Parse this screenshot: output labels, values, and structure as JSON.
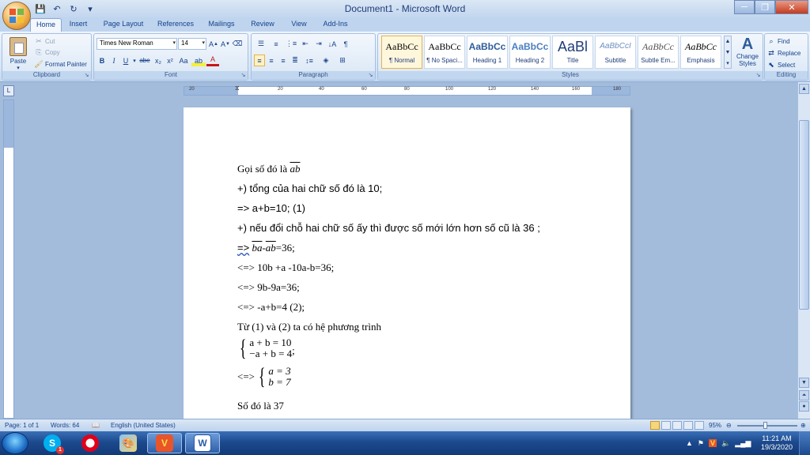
{
  "window": {
    "title": "Document1 - Microsoft Word",
    "minimize_icon": "minimize-icon",
    "maximize_icon": "restore-icon",
    "close_icon": "close-icon"
  },
  "quick_access": [
    "save-icon",
    "undo-icon",
    "redo-icon",
    "customize-icon"
  ],
  "ribbon_tabs": [
    "Home",
    "Insert",
    "Page Layout",
    "References",
    "Mailings",
    "Review",
    "View",
    "Add-Ins"
  ],
  "clipboard": {
    "paste": "Paste",
    "cut": "Cut",
    "copy": "Copy",
    "format_painter": "Format Painter",
    "label": "Clipboard"
  },
  "font": {
    "name": "Times New Roman",
    "size": "14",
    "label": "Font",
    "buttons": [
      "B",
      "I",
      "U",
      "abe",
      "x₂",
      "x²",
      "Aa"
    ]
  },
  "paragraph": {
    "label": "Paragraph"
  },
  "styles": {
    "label": "Styles",
    "items": [
      {
        "sample": "AaBbCc",
        "name": "¶ Normal"
      },
      {
        "sample": "AaBbCc",
        "name": "¶ No Spaci..."
      },
      {
        "sample": "AaBbCc",
        "name": "Heading 1"
      },
      {
        "sample": "AaBbCc",
        "name": "Heading 2"
      },
      {
        "sample": "AaBl",
        "name": "Title"
      },
      {
        "sample": "AaBbCcI",
        "name": "Subtitle"
      },
      {
        "sample": "AaBbCc",
        "name": "Subtle Em..."
      },
      {
        "sample": "AaBbCc",
        "name": "Emphasis"
      }
    ],
    "change_styles": "Change Styles"
  },
  "editing": {
    "label": "Editing",
    "find": "Find",
    "replace": "Replace",
    "select": "Select"
  },
  "ruler": {
    "numbers": [
      "20",
      "20",
      "40",
      "60",
      "80",
      "100",
      "120",
      "140",
      "160",
      "180"
    ]
  },
  "document": {
    "lines": {
      "l1_prefix": "Gọi số đó là ",
      "l1_overline": "ab",
      "l2": "+) tổng của hai chữ số đó là 10;",
      "l3": "=> a+b=10;   (1)",
      "l4": "+) nếu đổi chỗ hai chữ số ấy thì được số mới lớn hơn số cũ là 36 ;",
      "l5_prefix": "=>",
      "l5_a": "ba",
      "l5_sep": "-",
      "l5_b": "ab",
      "l5_suffix": "=36;",
      "l6": "<=> 10b +a -10a-b=36;",
      "l7": "<=> 9b-9a=36;",
      "l8": "<=> -a+b=4    (2);",
      "l9": "Từ (1) và (2) ta có hệ phương trình",
      "sys1_row1": "a + b = 10",
      "sys1_row2": "−a + b = 4",
      "sys1_tail": ";",
      "sys2_prefix": "<=>",
      "sys2_row1": "a = 3",
      "sys2_row2": "b = 7",
      "l12": "Số đó là 37"
    }
  },
  "statusbar": {
    "page": "Page: 1 of 1",
    "words": "Words: 64",
    "language": "English (United States)",
    "zoom": "95%",
    "zoom_fraction": 0.95
  },
  "taskbar": {
    "apps": [
      "skype",
      "opera",
      "paint",
      "unikey",
      "word"
    ],
    "skype_badge": "1",
    "time": "11:21 AM",
    "date": "19/3/2020"
  },
  "colors": {
    "accent": "#15428b",
    "ribbon_bg": "#d6e5f6",
    "workspace_bg": "#a3bcdc"
  }
}
